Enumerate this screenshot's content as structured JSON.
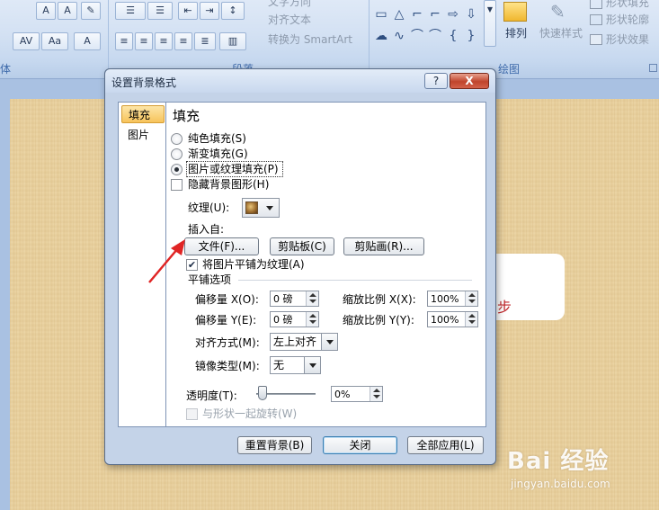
{
  "ribbon": {
    "font_group": {
      "label": "体",
      "font_grow_label": "A",
      "font_shrink_label": "A",
      "char_spacing_label": "AV",
      "change_case_label": "Aa",
      "font_color_label": "A"
    },
    "paragraph_group": {
      "label": "段落",
      "text_direction_label": "文字方向",
      "align_text_label": "对齐文本",
      "convert_smartart_label": "转换为 SmartArt"
    },
    "drawing_group": {
      "label": "绘图",
      "arrange_label": "排列",
      "quick_styles_label": "快速样式",
      "shape_fill_label": "形状填充",
      "shape_outline_label": "形状轮廓",
      "shape_effects_label": "形状效果"
    }
  },
  "slide": {
    "text_fragment": "步"
  },
  "dialog": {
    "title": "设置背景格式",
    "help_label": "?",
    "close_label": "X",
    "nav": [
      {
        "label": "填充",
        "active": true
      },
      {
        "label": "图片",
        "active": false
      }
    ],
    "heading": "填充",
    "fill_options": [
      {
        "label": "纯色填充(S)",
        "selected": false
      },
      {
        "label": "渐变填充(G)",
        "selected": false
      },
      {
        "label": "图片或纹理填充(P)",
        "selected": true
      }
    ],
    "hide_bg_graphics": {
      "label": "隐藏背景图形(H)",
      "checked": false
    },
    "texture_label": "纹理(U):",
    "insert_from_label": "插入自:",
    "insert_buttons": {
      "file": "文件(F)...",
      "clipboard": "剪贴板(C)",
      "clipart": "剪贴画(R)..."
    },
    "tile_picture": {
      "label": "将图片平铺为纹理(A)",
      "checked": true
    },
    "tiling_options_label": "平铺选项",
    "offset_x": {
      "label": "偏移量 X(O):",
      "value": "0 磅"
    },
    "offset_y": {
      "label": "偏移量 Y(E):",
      "value": "0 磅"
    },
    "scale_x": {
      "label": "缩放比例 X(X):",
      "value": "100%"
    },
    "scale_y": {
      "label": "缩放比例 Y(Y):",
      "value": "100%"
    },
    "alignment": {
      "label": "对齐方式(M):",
      "value": "左上对齐"
    },
    "mirror_type": {
      "label": "镜像类型(M):",
      "value": "无"
    },
    "transparency": {
      "label": "透明度(T):",
      "value": "0%",
      "level": 0
    },
    "rotate_with_shape": {
      "label": "与形状一起旋转(W)",
      "checked": false,
      "disabled": true
    },
    "footer_buttons": {
      "reset": "重置背景(B)",
      "close": "关闭",
      "apply_all": "全部应用(L)"
    }
  },
  "watermark": {
    "logo": "Bai 经验",
    "url": "jingyan.baidu.com"
  },
  "colors": {
    "dialog_bg": "#c4d3e8",
    "ribbon_label": "#3e6aaa",
    "arrow_red": "#e02424",
    "slide_texture": "#e9d2a0"
  }
}
